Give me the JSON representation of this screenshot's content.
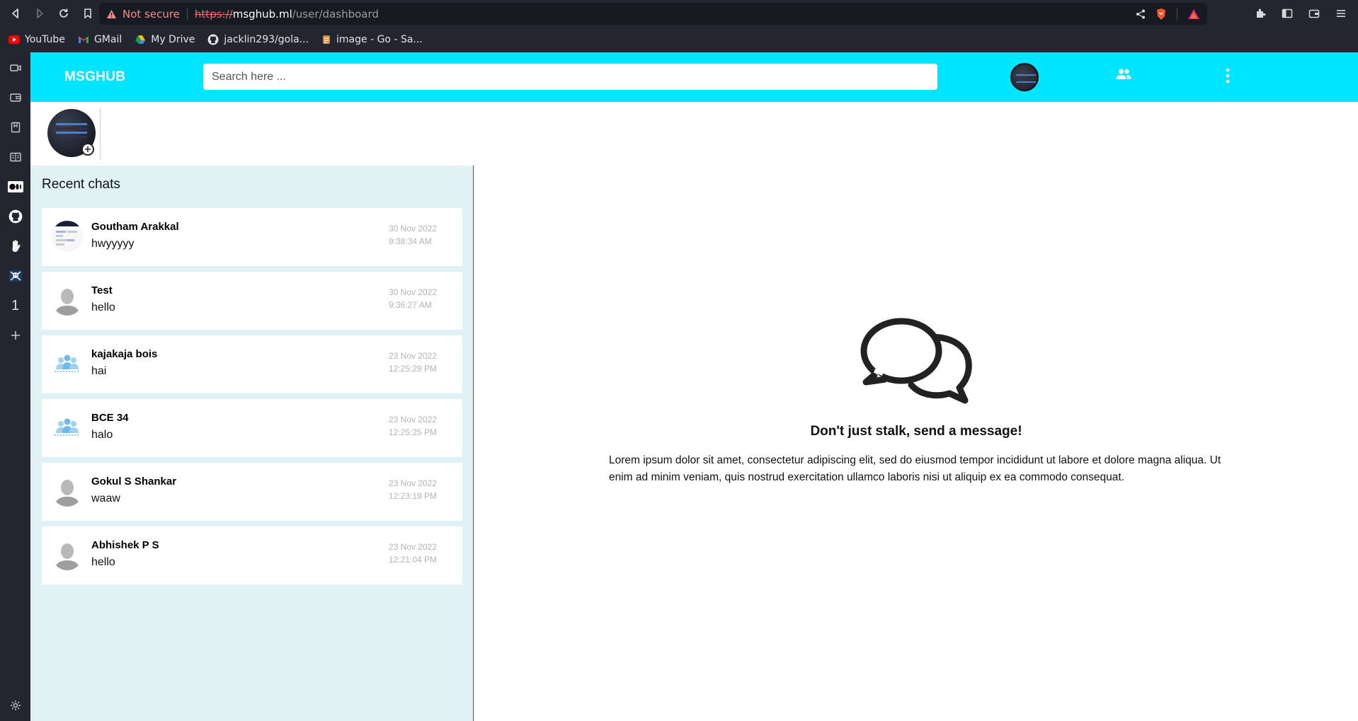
{
  "browser": {
    "security_label": "Not secure",
    "url_scheme": "https://",
    "url_host": "msghub.ml",
    "url_path": "/user/dashboard",
    "bookmarks": [
      {
        "label": "YouTube",
        "icon": "youtube-icon"
      },
      {
        "label": "GMail",
        "icon": "gmail-icon"
      },
      {
        "label": "My Drive",
        "icon": "drive-icon"
      },
      {
        "label": "jacklin293/gola...",
        "icon": "github-icon"
      },
      {
        "label": "image - Go - Sa...",
        "icon": "go-icon"
      }
    ],
    "sidebar_number": "1"
  },
  "app": {
    "logo": "MSGHUB",
    "search_placeholder": "Search here ...",
    "accent_color": "#00e5ff"
  },
  "recent_chats": {
    "title": "Recent chats",
    "items": [
      {
        "name": "Goutham Arakkal",
        "message": "hwyyyyy",
        "date": "30 Nov 2022",
        "time": "9:38:34 AM",
        "avatar": "screenshot-avatar"
      },
      {
        "name": "Test",
        "message": "hello",
        "date": "30 Nov 2022",
        "time": "9:36:27 AM",
        "avatar": "default-person-avatar"
      },
      {
        "name": "kajakaja bois",
        "message": "hai",
        "date": "23 Nov 2022",
        "time": "12:25:29 PM",
        "avatar": "group-avatar"
      },
      {
        "name": "BCE 34",
        "message": "halo",
        "date": "23 Nov 2022",
        "time": "12:25:25 PM",
        "avatar": "group-avatar"
      },
      {
        "name": "Gokul S Shankar",
        "message": "waaw",
        "date": "23 Nov 2022",
        "time": "12:23:19 PM",
        "avatar": "default-person-avatar"
      },
      {
        "name": "Abhishek P S",
        "message": "hello",
        "date": "23 Nov 2022",
        "time": "12:21:04 PM",
        "avatar": "default-person-avatar"
      }
    ]
  },
  "empty_state": {
    "title": "Don't just stalk, send a message!",
    "text": "Lorem ipsum dolor sit amet, consectetur adipiscing elit, sed do eiusmod tempor incididunt ut labore et dolore magna aliqua. Ut enim ad minim veniam, quis nostrud exercitation ullamco laboris nisi ut aliquip ex ea commodo consequat."
  }
}
